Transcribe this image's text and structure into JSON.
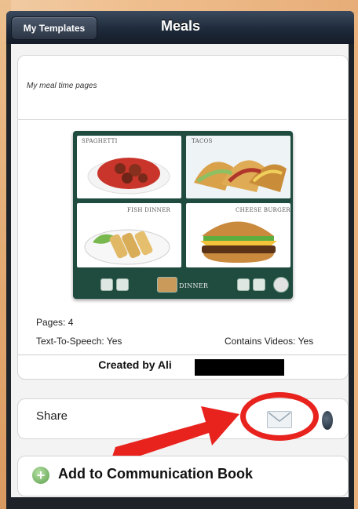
{
  "nav": {
    "back_label": "My Templates",
    "title": "Meals"
  },
  "template": {
    "description": "My meal time pages",
    "preview": {
      "tiles": [
        {
          "label": "Spaghetti"
        },
        {
          "label": "Tacos"
        },
        {
          "label": "Fish Dinner"
        },
        {
          "label": "Cheese Burger"
        }
      ],
      "bar_label": "Dinner"
    },
    "pages": "Pages: 4",
    "tts": "Text-To-Speech: Yes",
    "videos": "Contains Videos: Yes",
    "created_by": "Created by Ali"
  },
  "share": {
    "label": "Share",
    "icon": "mail-icon"
  },
  "add": {
    "label": "Add to Communication Book",
    "icon": "plus-icon"
  },
  "colors": {
    "annotation_red": "#e8231e",
    "preview_bg": "#1f4c3f",
    "navbar": "#1e2a3a"
  }
}
